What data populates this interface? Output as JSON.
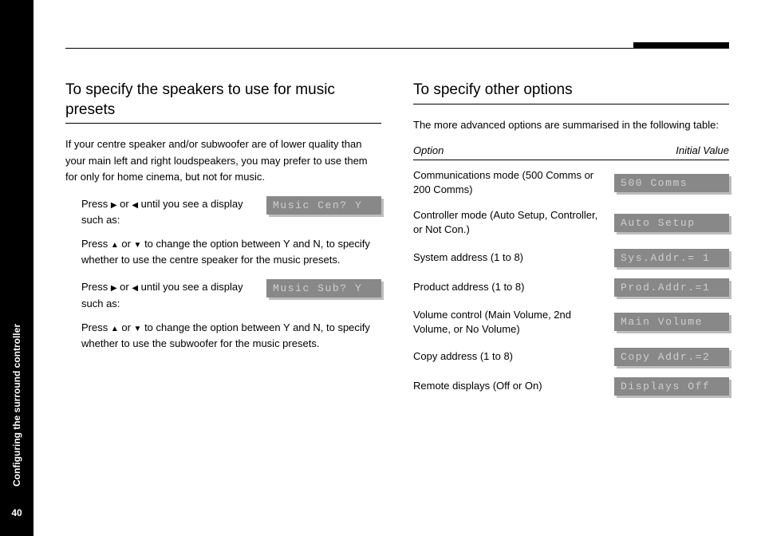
{
  "sidebar": {
    "section": "Configuring the surround controller",
    "page": "40"
  },
  "icons": {
    "right": "▶",
    "left": "◀",
    "up": "▲",
    "down": "▼"
  },
  "left": {
    "heading": "To specify the speakers to use for music presets",
    "intro": "If your centre speaker and/or subwoofer are of lower quality than your main left and right loudspeakers, you may prefer to use them for only for home cinema, but not for music.",
    "step1a": "Press ",
    "step1b": " or ",
    "step1c": " until you see a display such as:",
    "lcd1": "Music Cen? Y",
    "step2a": "Press ",
    "step2b": " or ",
    "step2c": " to change the option between Y and N, to specify whether to use the centre speaker for the music presets.",
    "step3a": "Press ",
    "step3b": " or ",
    "step3c": " until you see a display such as:",
    "lcd2": "Music Sub? Y",
    "step4a": "Press ",
    "step4b": " or ",
    "step4c": " to change the option between Y and N, to specify whether to use the subwoofer for the music presets."
  },
  "right": {
    "heading": "To specify other options",
    "intro": "The more advanced options are summarised in the following table:",
    "header_option": "Option",
    "header_value": "Initial Value",
    "rows": [
      {
        "label": "Communications mode (500 Comms or 200 Comms)",
        "lcd": "500 Comms"
      },
      {
        "label": "Controller mode (Auto Setup, Controller, or Not Con.)",
        "lcd": "Auto Setup"
      },
      {
        "label": "System address (1 to 8)",
        "lcd": "Sys.Addr.= 1"
      },
      {
        "label": "Product address (1 to 8)",
        "lcd": "Prod.Addr.=1"
      },
      {
        "label": "Volume control (Main Volume, 2nd Volume, or No Volume)",
        "lcd": "Main Volume"
      },
      {
        "label": "Copy address (1 to 8)",
        "lcd": "Copy Addr.=2"
      },
      {
        "label": "Remote displays (Off or On)",
        "lcd": "Displays Off"
      }
    ]
  }
}
